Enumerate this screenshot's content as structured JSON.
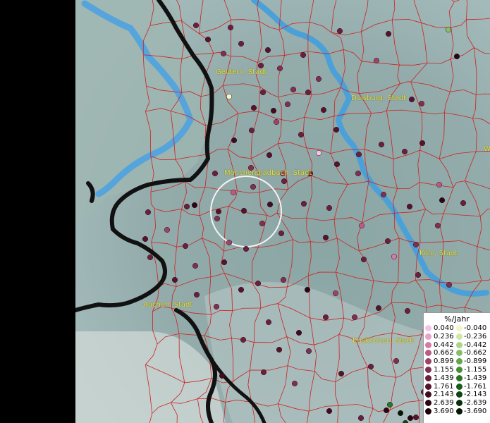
{
  "map": {
    "background": "#8fa8a8",
    "river_color": "#4aa0d8",
    "border_color": "#cc2222",
    "country_border_color": "#111111",
    "places": [
      {
        "id": "geldern",
        "label": "Geldern, Stadt"
      },
      {
        "id": "duisburg",
        "label": "Duisburg, Stadt"
      },
      {
        "id": "moenchengladbach",
        "label": "Mönchengladbach, Stadt"
      },
      {
        "id": "koeln",
        "label": "Köln, Stadt"
      },
      {
        "id": "aachen",
        "label": "Aachen, Stadt"
      },
      {
        "id": "euskirchen",
        "label": "Euskirchen, Stadt"
      },
      {
        "id": "edge_w",
        "label": "W"
      }
    ]
  },
  "legend": {
    "title": "%/Jahr",
    "positive": [
      {
        "label": "0.040",
        "color": "#f4c3e6"
      },
      {
        "label": "0.236",
        "color": "#e8a0cc"
      },
      {
        "label": "0.442",
        "color": "#d67aa8"
      },
      {
        "label": "0.662",
        "color": "#b85c86"
      },
      {
        "label": "0.899",
        "color": "#9a4468"
      },
      {
        "label": "1.155",
        "color": "#80304f"
      },
      {
        "label": "1.439",
        "color": "#6a203c"
      },
      {
        "label": "1.761",
        "color": "#55142c"
      },
      {
        "label": "2.143",
        "color": "#420b1f"
      },
      {
        "label": "2.639",
        "color": "#2c0513"
      },
      {
        "label": "3.690",
        "color": "#180208"
      }
    ],
    "negative": [
      {
        "label": "-0.040",
        "color": "#f2f7c8"
      },
      {
        "label": "-0.236",
        "color": "#cfe8a8"
      },
      {
        "label": "-0.442",
        "color": "#abd68a"
      },
      {
        "label": "-0.662",
        "color": "#85c067"
      },
      {
        "label": "-0.899",
        "color": "#62a84a"
      },
      {
        "label": "-1.155",
        "color": "#449034"
      },
      {
        "label": "-1.439",
        "color": "#2c7524"
      },
      {
        "label": "-1.761",
        "color": "#1a5c18"
      },
      {
        "label": "-2.143",
        "color": "#0e4510"
      },
      {
        "label": "-2.639",
        "color": "#063009"
      },
      {
        "label": "-3.690",
        "color": "#021a04"
      }
    ]
  },
  "stations": [
    {
      "id": "s1",
      "cls": 7
    },
    {
      "id": "s2",
      "cls": 8
    },
    {
      "id": "s3",
      "cls": 7
    },
    {
      "id": "s4",
      "cls": 7
    },
    {
      "id": "s5",
      "cls": 6
    },
    {
      "id": "s6",
      "cls": 8
    },
    {
      "id": "s7",
      "cls": 7
    },
    {
      "id": "s8",
      "cls": 6
    },
    {
      "id": "s9",
      "cls": -1
    },
    {
      "id": "s10",
      "cls": 7
    },
    {
      "id": "s11",
      "cls": 8
    },
    {
      "id": "s12",
      "cls": 9
    },
    {
      "id": "s13",
      "cls": 6
    },
    {
      "id": "s14",
      "cls": 7
    },
    {
      "id": "s15",
      "cls": 6
    },
    {
      "id": "s16",
      "cls": -4
    },
    {
      "id": "s17",
      "cls": 10
    },
    {
      "id": "s18",
      "cls": 7
    },
    {
      "id": "s19",
      "cls": 5
    },
    {
      "id": "s20",
      "cls": 8
    },
    {
      "id": "s21",
      "cls": 7
    },
    {
      "id": "s22",
      "cls": 6
    },
    {
      "id": "s23",
      "cls": 8
    },
    {
      "id": "s24",
      "cls": 8
    },
    {
      "id": "s25",
      "cls": 5
    },
    {
      "id": "s26",
      "cls": 7
    },
    {
      "id": "s27",
      "cls": 1
    },
    {
      "id": "s28",
      "cls": 8
    },
    {
      "id": "s29",
      "cls": 7
    },
    {
      "id": "s30",
      "cls": 9
    },
    {
      "id": "s31",
      "cls": 7
    },
    {
      "id": "s32",
      "cls": 4
    },
    {
      "id": "s33",
      "cls": 10
    },
    {
      "id": "s34",
      "cls": 7
    },
    {
      "id": "s35",
      "cls": 6
    },
    {
      "id": "s36",
      "cls": 5
    },
    {
      "id": "s37",
      "cls": 8
    },
    {
      "id": "s38",
      "cls": 7
    },
    {
      "id": "s39",
      "cls": 8
    },
    {
      "id": "s40",
      "cls": 6
    },
    {
      "id": "s41",
      "cls": 8
    },
    {
      "id": "s42",
      "cls": 7
    },
    {
      "id": "s43",
      "cls": 7
    },
    {
      "id": "s44",
      "cls": 6
    },
    {
      "id": "s45",
      "cls": 4
    },
    {
      "id": "s46",
      "cls": 7
    },
    {
      "id": "s47",
      "cls": 10
    },
    {
      "id": "s48",
      "cls": 8
    },
    {
      "id": "s49",
      "cls": 6
    },
    {
      "id": "s50",
      "cls": 7
    },
    {
      "id": "s51",
      "cls": 7
    },
    {
      "id": "s52",
      "cls": 8
    },
    {
      "id": "s53",
      "cls": 6
    },
    {
      "id": "s54",
      "cls": 5
    },
    {
      "id": "s55",
      "cls": 7
    },
    {
      "id": "s56",
      "cls": 6
    },
    {
      "id": "s57",
      "cls": 8
    },
    {
      "id": "s58",
      "cls": 4
    },
    {
      "id": "s59",
      "cls": 7
    },
    {
      "id": "s60",
      "cls": 6
    },
    {
      "id": "s61",
      "cls": 6
    },
    {
      "id": "s62",
      "cls": 7
    },
    {
      "id": "s63",
      "cls": 8
    },
    {
      "id": "s64",
      "cls": 7
    },
    {
      "id": "s65",
      "cls": 6
    },
    {
      "id": "s66",
      "cls": 8
    },
    {
      "id": "s67",
      "cls": 7
    },
    {
      "id": "s68",
      "cls": 7
    },
    {
      "id": "s69",
      "cls": 6
    },
    {
      "id": "s70",
      "cls": 10
    },
    {
      "id": "s71",
      "cls": 5
    },
    {
      "id": "s72",
      "cls": 7
    },
    {
      "id": "s73",
      "cls": 3
    },
    {
      "id": "s74",
      "cls": 7
    },
    {
      "id": "s75",
      "cls": 6
    },
    {
      "id": "s76",
      "cls": 8
    },
    {
      "id": "s77",
      "cls": 5
    },
    {
      "id": "s78",
      "cls": 7
    },
    {
      "id": "s79",
      "cls": 7
    },
    {
      "id": "s80",
      "cls": 6
    },
    {
      "id": "s81",
      "cls": 8
    },
    {
      "id": "s82",
      "cls": 7
    },
    {
      "id": "s83",
      "cls": 9
    },
    {
      "id": "s84",
      "cls": 7
    },
    {
      "id": "s85",
      "cls": 6
    },
    {
      "id": "s86",
      "cls": 8
    },
    {
      "id": "s87",
      "cls": 7
    },
    {
      "id": "s88",
      "cls": 8
    },
    {
      "id": "s89",
      "cls": 6
    },
    {
      "id": "s90",
      "cls": 7
    },
    {
      "id": "s91",
      "cls": 9
    },
    {
      "id": "s92",
      "cls": 7
    },
    {
      "id": "s93",
      "cls": 6
    },
    {
      "id": "s94",
      "cls": 8
    },
    {
      "id": "s95",
      "cls": 7
    },
    {
      "id": "s96",
      "cls": 6
    },
    {
      "id": "s97",
      "cls": 9
    },
    {
      "id": "s98",
      "cls": 7
    },
    {
      "id": "s99",
      "cls": 10
    },
    {
      "id": "s100",
      "cls": 8
    },
    {
      "id": "s101",
      "cls": 7
    },
    {
      "id": "s102",
      "cls": -7
    },
    {
      "id": "s103",
      "cls": -11
    },
    {
      "id": "s104",
      "cls": 10
    },
    {
      "id": "s105",
      "cls": -9
    },
    {
      "id": "s106",
      "cls": 7
    },
    {
      "id": "s107",
      "cls": 8
    },
    {
      "id": "s108",
      "cls": 6
    },
    {
      "id": "s109",
      "cls": 9
    },
    {
      "id": "s110",
      "cls": 7
    }
  ]
}
